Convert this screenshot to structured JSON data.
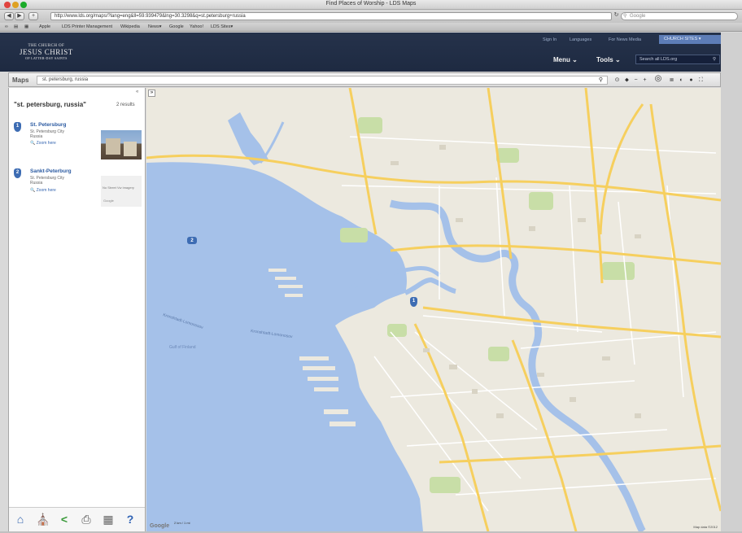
{
  "window": {
    "title": "Find Places of Worship - LDS Maps",
    "traffic_colors": [
      "#e0443e",
      "#dea123",
      "#1aab29"
    ]
  },
  "browser": {
    "back": "◀",
    "forward": "▶",
    "url": "http://www.lds.org/maps/?lang=eng&ll=59.939479&lng=30.3298&q=st.petersburg+russia",
    "search_placeholder": "Google",
    "bookmarks": [
      "Apple",
      "LDS Printer Management",
      "Wikipedia",
      "News▾",
      "Google",
      "Yahoo!",
      "LDS Sites▾"
    ]
  },
  "lds_header": {
    "logo_line1": "THE CHURCH OF",
    "logo_line2": "JESUS CHRIST",
    "logo_line3": "OF LATTER-DAY SAINTS",
    "sign_in": "Sign In",
    "languages": "Languages",
    "news_media": "For News Media",
    "church_sites": "CHURCH SITES ▾",
    "menu": "Menu ⌄",
    "tools": "Tools ⌄",
    "search_placeholder": "Search all LDS.org"
  },
  "maps_bar": {
    "label": "Maps",
    "query": "st. petersburg, russia",
    "tools": {
      "search": "⚲",
      "home": "⊙",
      "pin": "⬥",
      "zoom_out": "−",
      "zoom_in": "+",
      "pan": "◎",
      "layers": "≣",
      "globe": "◐",
      "settings": "●",
      "fullscreen": "⛶"
    }
  },
  "sidebar": {
    "result_title": "\"st. petersburg, russia\"",
    "result_count": "2 results",
    "collapse": "«",
    "results": [
      {
        "marker": "1",
        "name": "St. Petersburg",
        "address": [
          "St. Petersburg City",
          "Russia"
        ],
        "zoom": "Zoom here"
      },
      {
        "marker": "2",
        "name": "Sankt-Peterburg",
        "address": [
          "St. Petersburg City",
          "Russia"
        ],
        "zoom": "Zoom here"
      }
    ],
    "street_view_note": "No Street Vw imagery",
    "street_view_brand": "Google",
    "footer_icons": {
      "home": "⌂",
      "temple": "⛪",
      "share": "<",
      "print": "⎙",
      "settings": "▦",
      "help": "?"
    }
  },
  "map": {
    "collapse": "»",
    "markers": [
      "1",
      "2"
    ],
    "scale": "2 km / 1 mi",
    "google": "Google",
    "map_data": "Map data ©2012",
    "labels": [
      "Gulf of Finland",
      "Kronshtadt-Lomonosov"
    ],
    "colors": {
      "water": "#a5c1e9",
      "land": "#ece9df",
      "park": "#c8dea7",
      "major_road": "#f6cf5e",
      "road": "#ffffff"
    }
  }
}
